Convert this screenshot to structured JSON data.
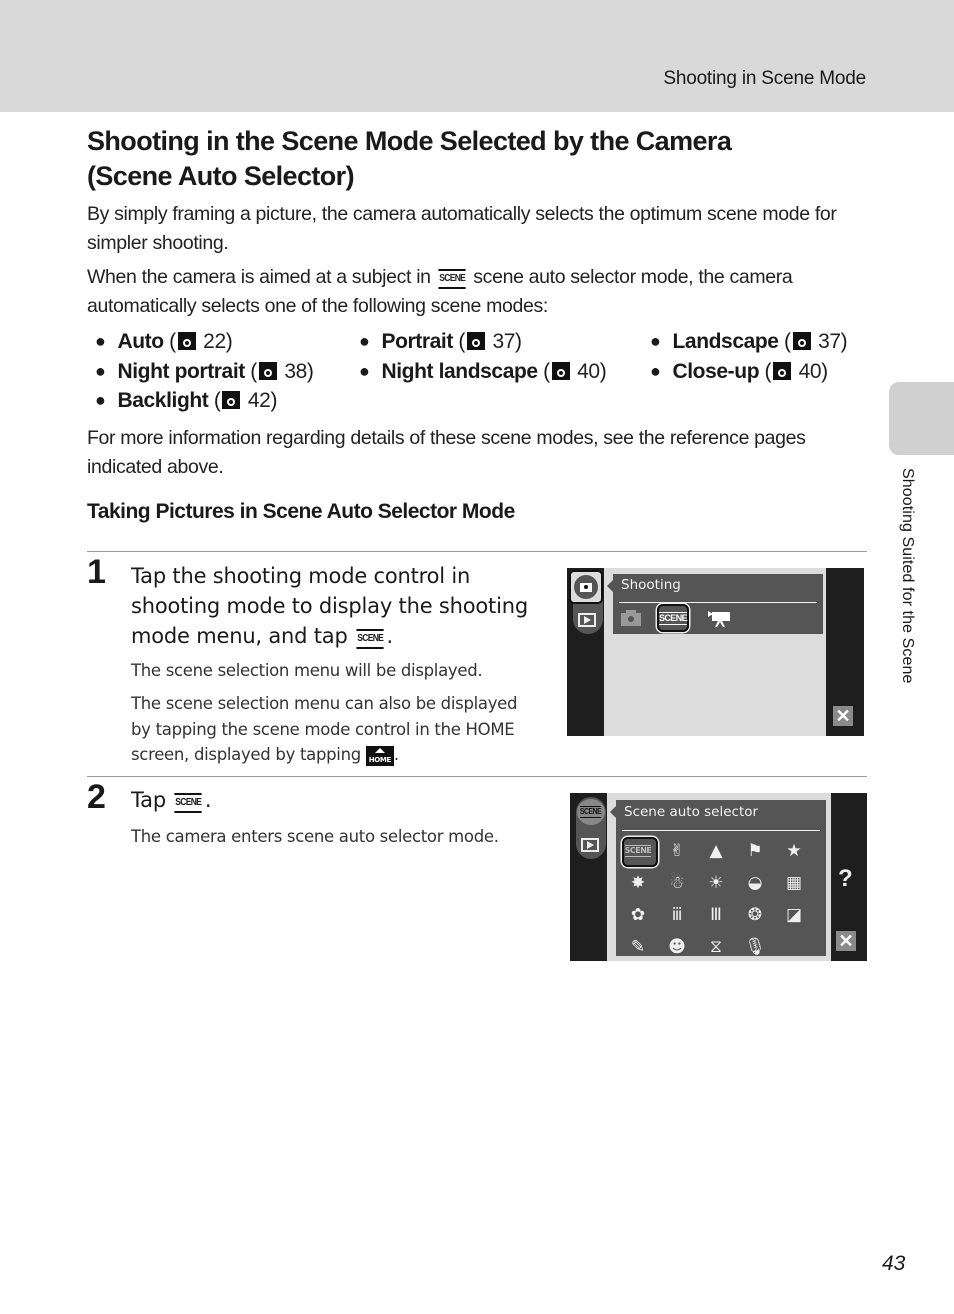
{
  "header": {
    "running_head": "Shooting in Scene Mode"
  },
  "side_tab": {
    "label": "Shooting Suited for the Scene"
  },
  "title": "Shooting in the Scene Mode Selected by the Camera (Scene Auto Selector)",
  "intro": {
    "p1": "By simply framing a picture, the camera automatically selects the optimum scene mode for simpler shooting.",
    "p2_before": "When the camera is aimed at a subject in ",
    "p2_icon": "scene-auto-selector-icon",
    "p2_after": " scene auto selector mode, the camera automatically selects one of the following scene modes:"
  },
  "scene_modes": [
    {
      "name": "Auto",
      "ref_icon": "reference-page-icon",
      "page": "22"
    },
    {
      "name": "Portrait",
      "ref_icon": "reference-page-icon",
      "page": "37"
    },
    {
      "name": "Landscape",
      "ref_icon": "reference-page-icon",
      "page": "37"
    },
    {
      "name": "Night portrait",
      "ref_icon": "reference-page-icon",
      "page": "38"
    },
    {
      "name": "Night landscape",
      "ref_icon": "reference-page-icon",
      "page": "40"
    },
    {
      "name": "Close-up",
      "ref_icon": "reference-page-icon",
      "page": "40"
    },
    {
      "name": "Backlight",
      "ref_icon": "reference-page-icon",
      "page": "42"
    }
  ],
  "more_info": "For more information regarding details of these scene modes, see the reference pages indicated above.",
  "section_heading": "Taking Pictures in Scene Auto Selector Mode",
  "steps": [
    {
      "number": "1",
      "instruction_before": "Tap the shooting mode control in shooting mode to display the shooting mode menu, and tap ",
      "instruction_icon": "scene-icon",
      "instruction_icon_text": "SCENE",
      "instruction_after": ".",
      "notes": [
        "The scene selection menu will be displayed.",
        "The scene selection menu can also be displayed by tapping the scene mode control in the HOME screen, displayed by tapping "
      ],
      "home_icon_text": "HOME",
      "note2_after": ".",
      "screen": {
        "menu_title": "Shooting",
        "menu_icons": [
          "camera-auto-icon",
          "scene-icon",
          "movie-icon"
        ],
        "selected_icon": "scene-icon",
        "scene_label": "SCENE",
        "close_icon": "close-icon"
      }
    },
    {
      "number": "2",
      "instruction_before": "Tap ",
      "instruction_icon": "scene-auto-selector-icon",
      "instruction_icon_text": "SCENE",
      "instruction_after": ".",
      "notes": [
        "The camera enters scene auto selector mode."
      ],
      "screen": {
        "menu_title": "Scene auto selector",
        "side_label": "SCENE",
        "help_label": "?",
        "selected_icon": "scene-auto-selector-icon",
        "selected_label": "SCENE",
        "grid_icons": [
          [
            "scene-auto-selector-icon",
            "portrait-icon",
            "landscape-icon",
            "sports-icon",
            "night-portrait-icon"
          ],
          [
            "party-indoor-icon",
            "beach-snow-icon",
            "sunset-icon",
            "dusk-dawn-icon",
            "night-landscape-icon"
          ],
          [
            "close-up-icon",
            "food-icon",
            "museum-icon",
            "fireworks-icon",
            "copy-icon"
          ],
          [
            "draw-icon",
            "backlight-icon",
            "panorama-icon",
            "voice-recording-icon"
          ]
        ],
        "grid_glyphs": [
          [
            "",
            "✌",
            "▲",
            "⚑",
            "★"
          ],
          [
            "✸",
            "☃",
            "☀",
            "◒",
            "▦"
          ],
          [
            "✿",
            "ⅲ",
            "Ⅲ",
            "❂",
            "◪"
          ],
          [
            "✎",
            "☻",
            "⧖",
            "🎙"
          ]
        ]
      }
    }
  ],
  "page_number": "43"
}
